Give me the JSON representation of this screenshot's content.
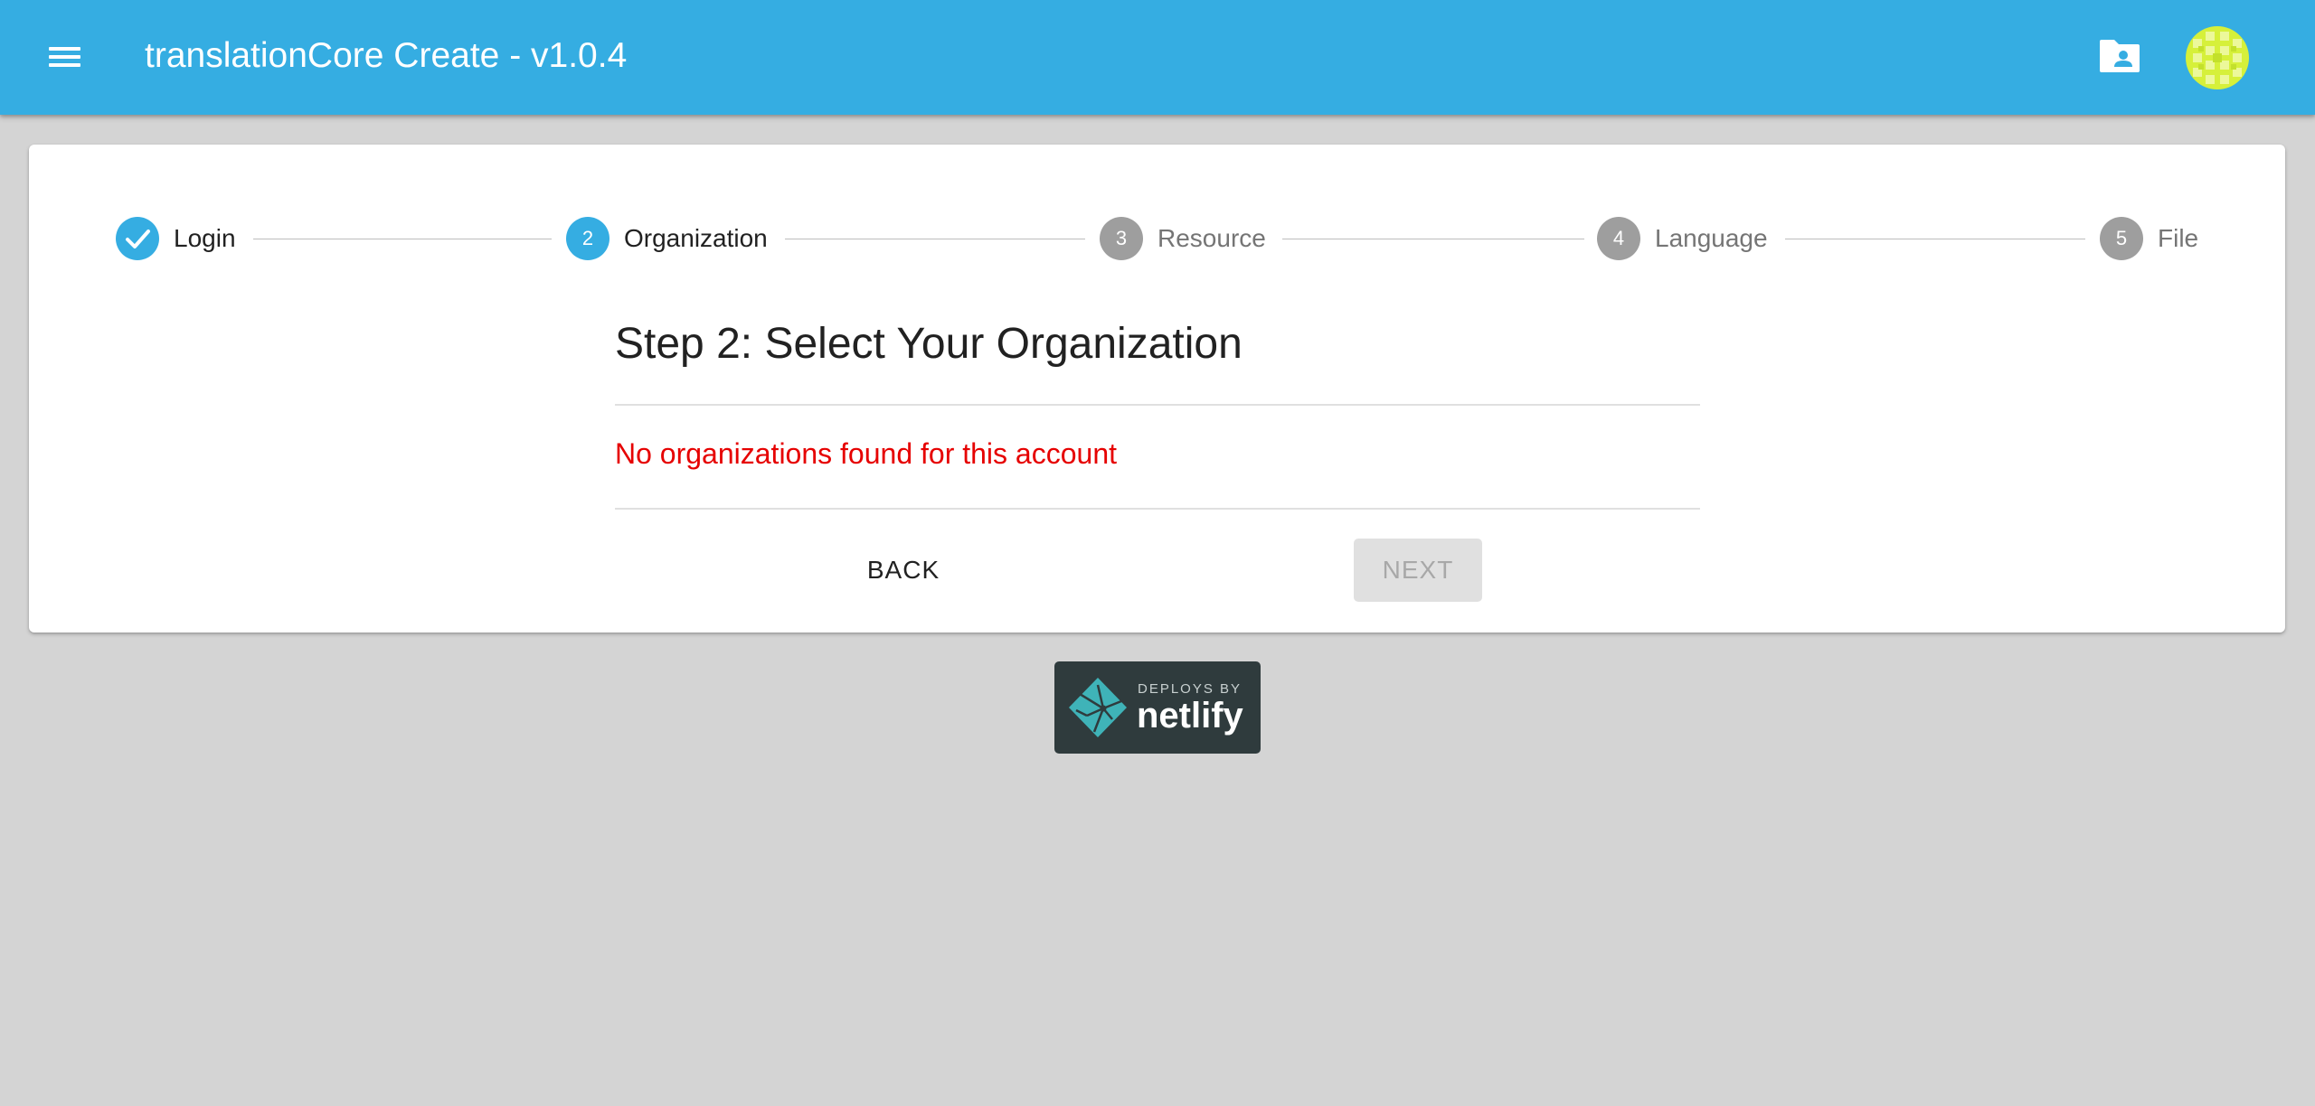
{
  "app": {
    "title": "translationCore Create - v1.0.4",
    "accent_color": "#35ade2"
  },
  "header": {
    "menu_icon": "hamburger-menu-icon",
    "folder_icon": "folder-account-icon",
    "avatar_icon": "user-avatar-icon"
  },
  "stepper": {
    "steps": [
      {
        "label": "Login",
        "number": "1",
        "state": "completed",
        "icon": "check-icon"
      },
      {
        "label": "Organization",
        "number": "2",
        "state": "active"
      },
      {
        "label": "Resource",
        "number": "3",
        "state": "inactive"
      },
      {
        "label": "Language",
        "number": "4",
        "state": "inactive"
      },
      {
        "label": "File",
        "number": "5",
        "state": "inactive"
      }
    ]
  },
  "content": {
    "heading": "Step 2: Select Your Organization",
    "error_message": "No organizations found for this account",
    "error_color": "#e60000"
  },
  "actions": {
    "back_label": "Back",
    "next_label": "Next",
    "next_disabled": true
  },
  "footer": {
    "badge_small": "DEPLOYS BY",
    "badge_big": "netlify",
    "badge_icon": "netlify-logo-icon"
  }
}
